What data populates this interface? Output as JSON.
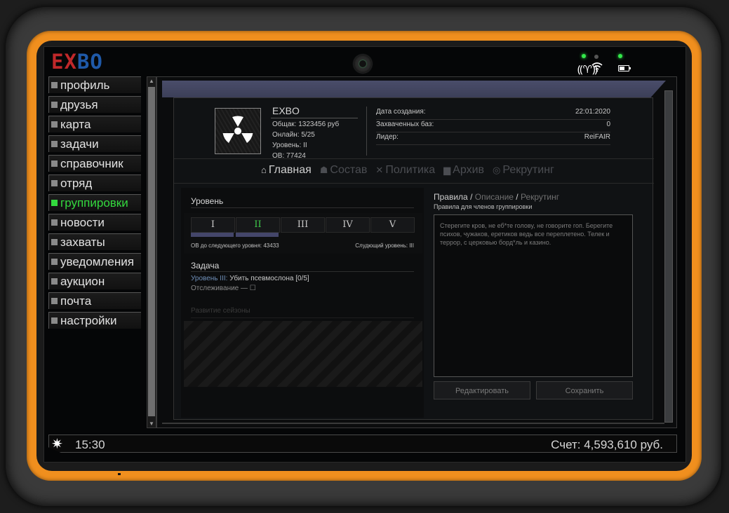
{
  "logo": {
    "part1": "EX",
    "part2": "BO"
  },
  "sidebar": {
    "items": [
      {
        "label": "профиль"
      },
      {
        "label": "друзья"
      },
      {
        "label": "карта"
      },
      {
        "label": "задачи"
      },
      {
        "label": "справочник"
      },
      {
        "label": "отряд"
      },
      {
        "label": "группировки",
        "active": true
      },
      {
        "label": "новости"
      },
      {
        "label": "захваты"
      },
      {
        "label": "уведомления"
      },
      {
        "label": "аукцион"
      },
      {
        "label": "почта"
      },
      {
        "label": "настройки"
      }
    ]
  },
  "group": {
    "name": "EXBO",
    "total": "Общак: 1323456 руб",
    "online": "Онлайн: 5/25",
    "level": "Уровень: II",
    "ob": "ОВ: 77424",
    "meta": [
      {
        "label": "Дата создания:",
        "value": "22:01:2020"
      },
      {
        "label": "Захваченных баз:",
        "value": "0"
      },
      {
        "label": "Лидер:",
        "value": "ReiFAIR"
      }
    ]
  },
  "tabs": [
    {
      "icon": "home-icon",
      "glyph": "⌂",
      "label": "Главная",
      "active": true
    },
    {
      "icon": "members-icon",
      "glyph": "☗",
      "label": "Состав"
    },
    {
      "icon": "politics-icon",
      "glyph": "✕",
      "label": "Политика"
    },
    {
      "icon": "archive-icon",
      "glyph": "▆",
      "label": "Архив"
    },
    {
      "icon": "recruit-icon",
      "glyph": "◎",
      "label": "Рекрутинг"
    }
  ],
  "level_section": {
    "title": "Уровень",
    "levels": [
      "I",
      "II",
      "III",
      "IV",
      "V"
    ],
    "active_index": 1,
    "ob_to_next": "ОВ до следующего уровня: 43433",
    "next_level": "Слудющий уровень: III"
  },
  "task_section": {
    "title": "Задача",
    "task_level": "Уровень III:",
    "task_text": " Убить псевмослона [0/5]",
    "tracking": "Отслеживание — ☐",
    "season": "Развитие сейзоны"
  },
  "rules": {
    "title_active": "Правила",
    "sep1": " / ",
    "title_desc": "Описание",
    "sep2": " / ",
    "title_recruit": "Рекрутинг",
    "subtitle": "Правила для членов группировки",
    "text": "Стерегите кров, не еб*те голову, не говорите гоп. Берегите психов, чужаков, еретиков ведь все переплетено. Телек и террор, с церковью борд*ль и казино.",
    "edit_button": "Редактировать",
    "save_button": "Сохранить"
  },
  "footer": {
    "time": "15:30",
    "balance": "Счет: 4,593,610 руб."
  },
  "colors": {
    "orange_casing": "#f08f1e",
    "active_green": "#33d93e",
    "logo_red": "#c0282a",
    "logo_blue": "#1f59a8",
    "level_bar": "#44466a"
  }
}
